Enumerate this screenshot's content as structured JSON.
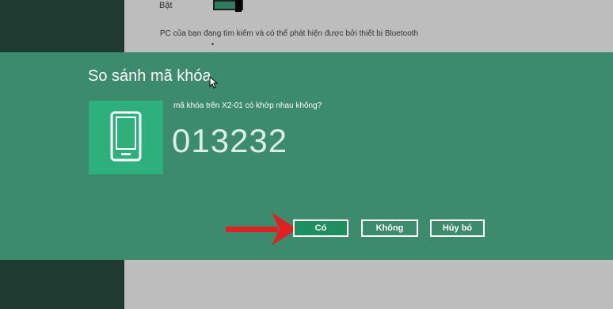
{
  "background": {
    "toggle_label": "Bật",
    "bluetooth_description": "PC của bạn đang tìm kiếm và có thể phát hiện được bởi thiết bị Bluetooth"
  },
  "dialog": {
    "title": "So sánh mã khóa",
    "question": "mã khóa trên X2-01 có khớp nhau không?",
    "passkey": "013232",
    "device_icon": "phone-icon",
    "buttons": {
      "yes": "Có",
      "no": "Không",
      "cancel": "Hủy bỏ"
    }
  },
  "colors": {
    "dialog_bg": "#3d8b6d",
    "tile_bg": "#2eb07d",
    "primary_button": "#1e8f5e",
    "arrow": "#e02020"
  }
}
